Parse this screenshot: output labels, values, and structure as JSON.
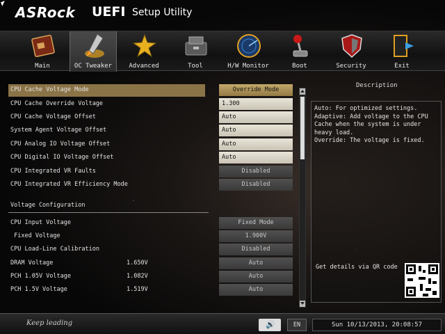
{
  "header": {
    "brand": "ASRock",
    "uefi": "UEFI",
    "subtitle": "Setup Utility"
  },
  "tabs": [
    {
      "label": "Main",
      "icon": "main-board-icon"
    },
    {
      "label": "OC Tweaker",
      "icon": "rocket-icon",
      "active": true
    },
    {
      "label": "Advanced",
      "icon": "star-icon"
    },
    {
      "label": "Tool",
      "icon": "toolbox-icon"
    },
    {
      "label": "H/W Monitor",
      "icon": "radar-icon"
    },
    {
      "label": "Boot",
      "icon": "joystick-icon"
    },
    {
      "label": "Security",
      "icon": "shield-icon"
    },
    {
      "label": "Exit",
      "icon": "exit-door-icon"
    }
  ],
  "settings": {
    "rows": [
      {
        "name": "CPU Cache Voltage Mode",
        "value": "Override Mode"
      },
      {
        "name": "CPU Cache Override Voltage",
        "value": "1.300"
      },
      {
        "name": "CPU Cache Voltage Offset",
        "value": "Auto"
      },
      {
        "name": "System Agent Voltage Offset",
        "value": "Auto"
      },
      {
        "name": "CPU Analog IO Voltage Offset",
        "value": "Auto"
      },
      {
        "name": "CPU Digital IO Voltage Offset",
        "value": "Auto"
      },
      {
        "name": "CPU Integrated VR Faults",
        "value": "Disabled"
      },
      {
        "name": "CPU Integrated VR Efficiency Mode",
        "value": "Disabled"
      }
    ],
    "section_title": "Voltage Configuration",
    "voltage_rows": [
      {
        "name": "CPU Input Voltage",
        "reading": "",
        "value": "Fixed Mode"
      },
      {
        "name": " Fixed Voltage",
        "reading": "",
        "value": "1.900V"
      },
      {
        "name": "CPU Load-Line Calibration",
        "reading": "",
        "value": "Disabled"
      },
      {
        "name": "DRAM Voltage",
        "reading": "1.650V",
        "value": "Auto"
      },
      {
        "name": "PCH 1.05V Voltage",
        "reading": "1.082V",
        "value": "Auto"
      },
      {
        "name": "PCH 1.5V Voltage",
        "reading": "1.519V",
        "value": "Auto"
      }
    ]
  },
  "description": {
    "title": "Description",
    "text": "Auto: For optimized settings.\nAdaptive: Add voltage to the CPU Cache when the system is under heavy load.\nOverride: The voltage is fixed.",
    "qr_label": "Get details via QR code"
  },
  "footer": {
    "slogan": "Keep leading",
    "language": "EN",
    "datetime": "Sun 10/13/2013, 20:08:57"
  },
  "colors": {
    "selected_row": "#8a7346",
    "value_light": "#e8e4d8",
    "value_dark": "#474747"
  }
}
